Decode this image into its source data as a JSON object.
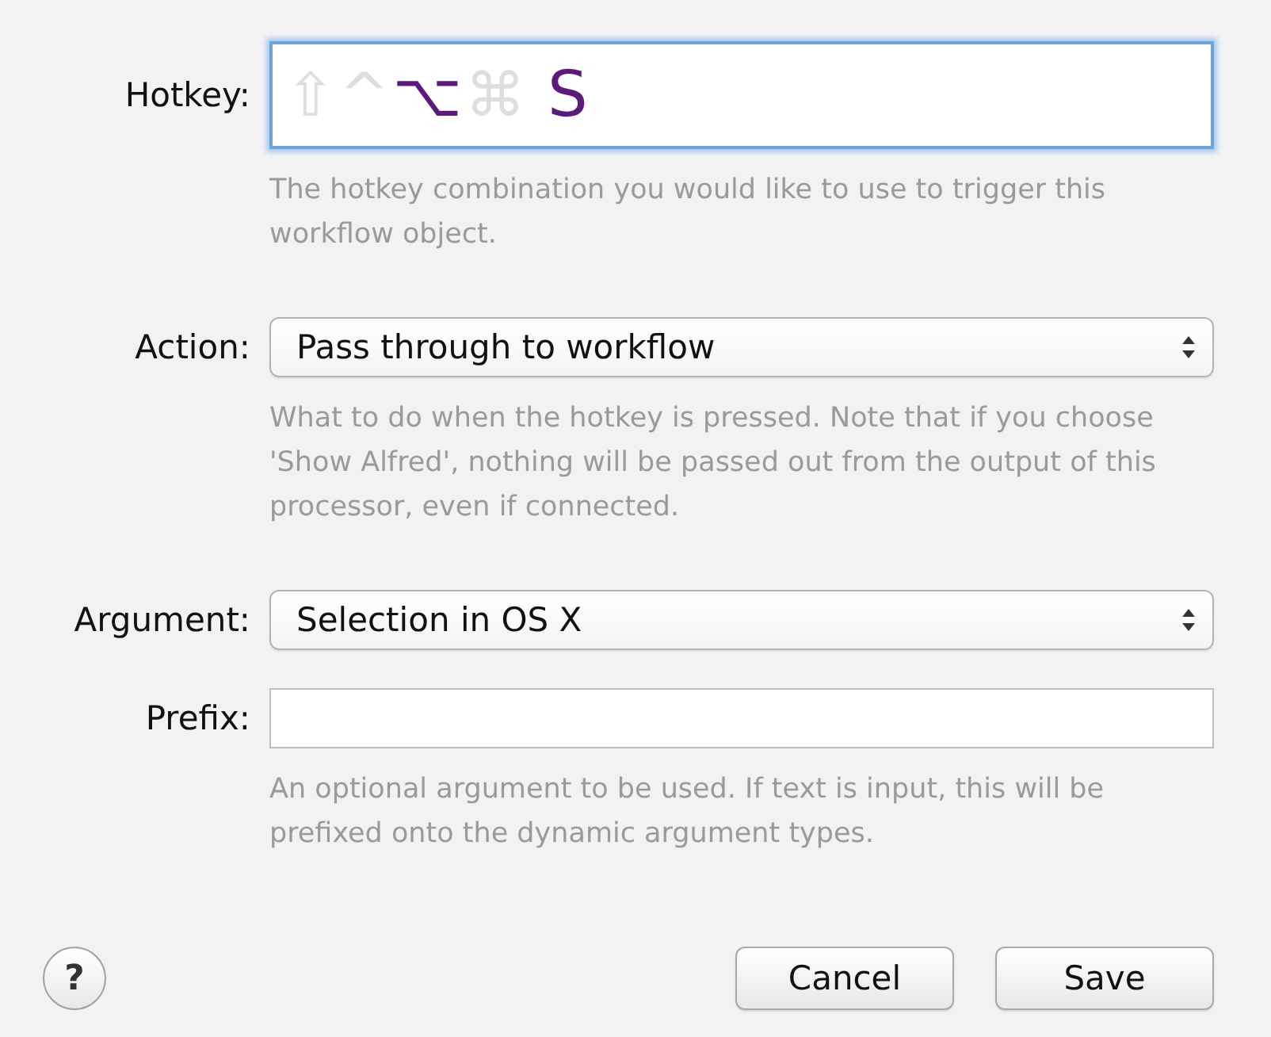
{
  "fields": [
    {
      "kind": "hotkey",
      "label": "Hotkey:",
      "modifiers": [
        {
          "symbol": "⇧",
          "on": false
        },
        {
          "symbol": "^",
          "on": false
        },
        {
          "symbol": "⌥",
          "on": true
        },
        {
          "symbol": "⌘",
          "on": false
        }
      ],
      "key": "S",
      "hint": "The hotkey combination you would like to use to trigger this workflow object."
    },
    {
      "kind": "popup",
      "label": "Action:",
      "value": "Pass through to workflow",
      "hint": "What to do when the hotkey is pressed. Note that if you choose 'Show Alfred', nothing will be passed out from the output of this processor, even if connected."
    },
    {
      "kind": "popup",
      "label": "Argument:",
      "value": "Selection in OS X"
    },
    {
      "kind": "text",
      "label": "Prefix:",
      "hint": "An optional argument to be used. If text is input, this will be prefixed onto the dynamic argument types."
    }
  ],
  "help_button": "?",
  "buttons": [
    {
      "label": "Cancel"
    },
    {
      "label": "Save"
    }
  ]
}
